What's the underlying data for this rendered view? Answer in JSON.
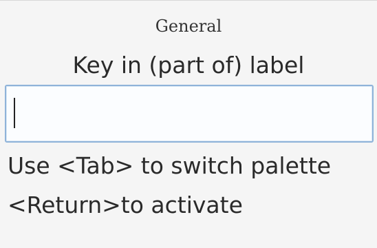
{
  "palette": {
    "title": "General",
    "prompt": "Key in (part of) label",
    "search": {
      "value": "",
      "placeholder": ""
    },
    "hints": [
      "Use <Tab> to switch palette",
      "<Return>to activate"
    ]
  },
  "colors": {
    "background": "#f5f5f5",
    "input_border": "#8fb3d9",
    "text": "#2a2a2a"
  }
}
